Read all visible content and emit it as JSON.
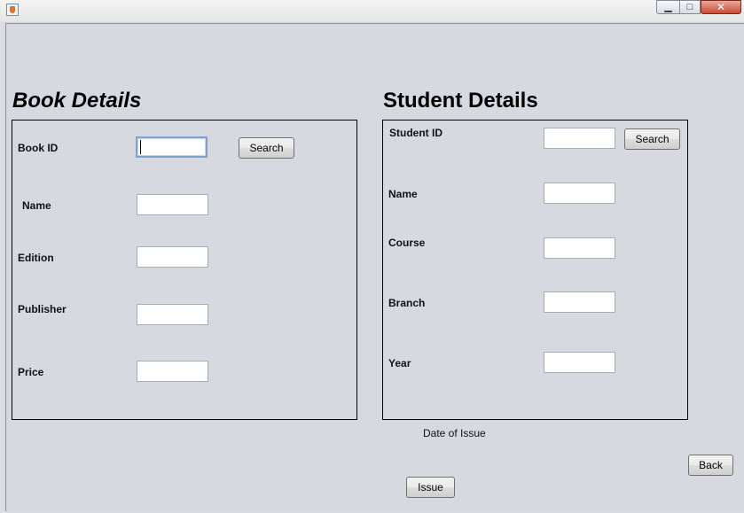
{
  "window": {
    "minimize": "▁",
    "maximize": "□",
    "close": "✕"
  },
  "book": {
    "title": "Book Details",
    "labels": {
      "id": "Book ID",
      "name": "Name",
      "edition": "Edition",
      "publisher": "Publisher",
      "price": "Price"
    },
    "values": {
      "id": "",
      "name": "",
      "edition": "",
      "publisher": "",
      "price": ""
    },
    "search_label": "Search"
  },
  "student": {
    "title": "Student Details",
    "labels": {
      "id": "Student ID",
      "name": "Name",
      "course": "Course",
      "branch": "Branch",
      "year": "Year"
    },
    "values": {
      "id": "",
      "name": "",
      "course": "",
      "branch": "",
      "year": ""
    },
    "search_label": "Search"
  },
  "issue": {
    "date_label": "Date of Issue",
    "issue_label": "Issue",
    "back_label": "Back"
  }
}
